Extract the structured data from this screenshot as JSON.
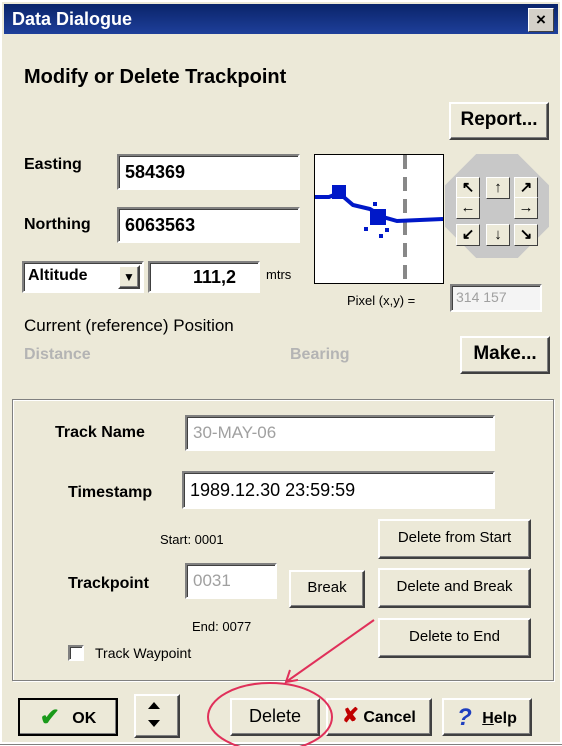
{
  "title": "Data Dialogue",
  "close_glyph": "×",
  "heading": "Modify or Delete Trackpoint",
  "report_label": "Report...",
  "easting": {
    "label": "Easting",
    "value": "584369"
  },
  "northing": {
    "label": "Northing",
    "value": "6063563"
  },
  "altitude": {
    "select": "Altitude",
    "value": "111,2",
    "unit": "mtrs"
  },
  "pixel": {
    "label": "Pixel (x,y) =",
    "value": "314 157"
  },
  "current_position_label": "Current (reference) Position",
  "distance_label": "Distance",
  "bearing_label": "Bearing",
  "make_label": "Make...",
  "track": {
    "name_label": "Track Name",
    "name_value": "30-MAY-06",
    "timestamp_label": "Timestamp",
    "timestamp_value": "1989.12.30 23:59:59",
    "start_text": "Start: 0001",
    "trackpoint_label": "Trackpoint",
    "trackpoint_value": "0031",
    "end_text": "End: 0077",
    "break_label": "Break",
    "delete_from_start_label": "Delete from Start",
    "delete_and_break_label": "Delete and Break",
    "delete_to_end_label": "Delete to End",
    "track_waypoint_label": "Track Waypoint"
  },
  "buttons": {
    "ok": "OK",
    "delete": "Delete",
    "cancel": "Cancel",
    "help": "Help",
    "help_hotkey": "H",
    "help_rest": "elp"
  },
  "arrows": {
    "nw": "↖",
    "n": "↑",
    "ne": "↗",
    "w": "←",
    "e": "→",
    "sw": "↙",
    "s": "↓",
    "se": "↘"
  },
  "colors": {
    "track_blue": "#0018c8",
    "annotation_red": "#e0305a",
    "title_blue": "#0a246a"
  }
}
